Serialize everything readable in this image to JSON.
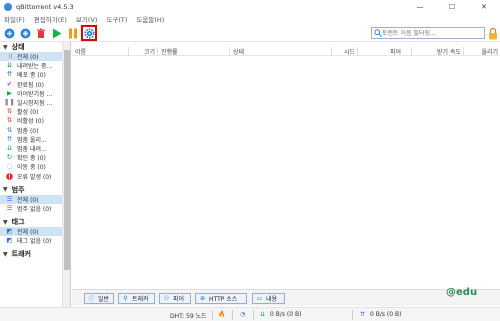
{
  "window": {
    "title": "qBittorrent v4.5.3",
    "minimize": "—",
    "maximize": "☐",
    "close": "✕"
  },
  "menu": [
    "파일(F)",
    "편집하기(E)",
    "보기(V)",
    "도구(T)",
    "도움말(H)"
  ],
  "toolbar": {
    "search_placeholder": "토렌트 이름 필터링...",
    "highlight_color": "#e00000"
  },
  "sidebar": {
    "status_title": "상태",
    "status_items": [
      {
        "label": "전체 (0)",
        "icon": "shuffle-icon",
        "selected": true
      },
      {
        "label": "내려받는 중...",
        "icon": "download-arrows-icon"
      },
      {
        "label": "배포 중 (0)",
        "icon": "upload-arrows-icon"
      },
      {
        "label": "완료됨 (0)",
        "icon": "check-icon"
      },
      {
        "label": "이어받기됨 ...",
        "icon": "play-icon"
      },
      {
        "label": "일시정지됨 ...",
        "icon": "pause-icon"
      },
      {
        "label": "활성 (0)",
        "icon": "active-icon"
      },
      {
        "label": "비활성 (0)",
        "icon": "inactive-icon"
      },
      {
        "label": "멈춤 (0)",
        "icon": "stalled-icon"
      },
      {
        "label": "멈춤 올리...",
        "icon": "stalled-up-icon"
      },
      {
        "label": "멈춤 내려...",
        "icon": "stalled-down-icon"
      },
      {
        "label": "확인 중 (0)",
        "icon": "checking-icon"
      },
      {
        "label": "이동 중 (0)",
        "icon": "moving-icon"
      },
      {
        "label": "오류 발생 (0)",
        "icon": "error-icon"
      }
    ],
    "category_title": "범주",
    "category_items": [
      {
        "label": "전체 (0)",
        "icon": "list-icon",
        "selected": true
      },
      {
        "label": "범주 없음 (0)",
        "icon": "list-icon"
      }
    ],
    "tag_title": "태그",
    "tag_items": [
      {
        "label": "전체 (0)",
        "icon": "tag-icon",
        "selected": true
      },
      {
        "label": "태그 없음 (0)",
        "icon": "tag-icon"
      }
    ],
    "tracker_title": "트래커"
  },
  "columns": [
    "이름",
    "크기",
    "진행률",
    "상태",
    "시드",
    "피어",
    "받기 속도",
    "올리기"
  ],
  "tabs": [
    {
      "label": "일반",
      "icon": "info-icon"
    },
    {
      "label": "트래커",
      "icon": "pin-icon"
    },
    {
      "label": "피어",
      "icon": "peers-icon"
    },
    {
      "label": "HTTP 소스",
      "icon": "globe-icon"
    },
    {
      "label": "내용",
      "icon": "folder-icon"
    }
  ],
  "status": {
    "dht": "DHT: 59 노드",
    "download": "0 B/s (0 B)",
    "upload": "0 B/s (0 B)"
  },
  "watermark": "@edu"
}
